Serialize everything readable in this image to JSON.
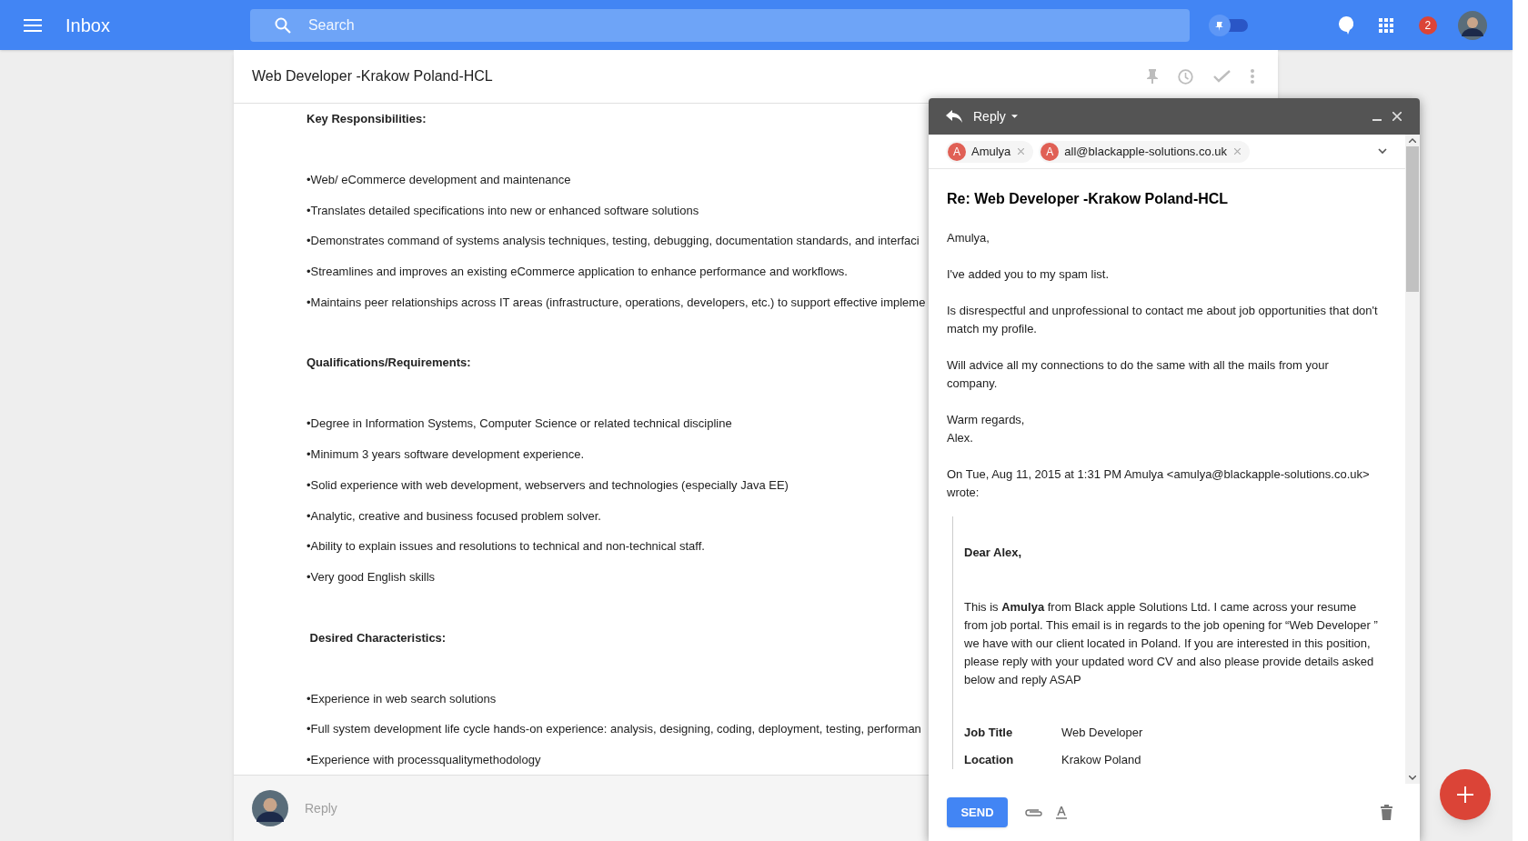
{
  "app_bar": {
    "title": "Inbox",
    "search": {
      "placeholder": "Search"
    },
    "notification_count": "2"
  },
  "thread": {
    "subject": "Web Developer -Krakow Poland-HCL",
    "body": [
      {
        "kind": "heading",
        "text": "Key Responsibilities:"
      },
      {
        "kind": "bullet",
        "text": "•Web/ eCommerce development and maintenance"
      },
      {
        "kind": "bullet",
        "text": "•Translates detailed specifications into new or enhanced software solutions"
      },
      {
        "kind": "bullet",
        "text": "•Demonstrates command of systems analysis techniques, testing, debugging, documentation standards, and interfaci"
      },
      {
        "kind": "bullet",
        "text": "•Streamlines and improves an existing eCommerce application to enhance performance and workflows."
      },
      {
        "kind": "bullet",
        "text": "•Maintains peer relationships across IT areas (infrastructure, operations, developers, etc.) to support effective impleme"
      },
      {
        "kind": "heading",
        "text": "Qualifications/Requirements:"
      },
      {
        "kind": "bullet",
        "text": "•Degree in Information Systems, Computer Science or related technical discipline"
      },
      {
        "kind": "bullet",
        "text": "•Minimum 3 years software development experience."
      },
      {
        "kind": "bullet",
        "text": "•Solid experience with web development, webservers and technologies (especially Java EE)"
      },
      {
        "kind": "bullet",
        "text": "•Analytic, creative and business focused problem solver."
      },
      {
        "kind": "bullet",
        "text": "•Ability to explain issues and resolutions to technical and non-technical staff."
      },
      {
        "kind": "bullet",
        "text": "•Very good English skills"
      },
      {
        "kind": "heading",
        "text": " Desired Characteristics:"
      },
      {
        "kind": "bullet",
        "text": "•Experience in web search solutions"
      },
      {
        "kind": "bullet",
        "text": "•Full system development life cycle hands-on experience: analysis, designing, coding, deployment, testing, performan"
      },
      {
        "kind": "bullet",
        "text": "•Experience with processqualitymethodology"
      }
    ],
    "reply": {
      "placeholder": "Reply"
    }
  },
  "compose": {
    "mode": "Reply",
    "recipients": [
      {
        "initial": "A",
        "label": "Amulya"
      },
      {
        "initial": "A",
        "label": "all@blackapple-solutions.co.uk"
      }
    ],
    "subject": "Re: Web Developer -Krakow Poland-HCL",
    "paragraphs": [
      "Amulya,",
      "I've added you to my spam list.",
      "Is disrespectful and unprofessional to contact me about job opportunities that don't match my profile.",
      "Will advice all my connections to do the same with all the mails from your company.",
      "Warm regards,\nAlex.",
      "On Tue, Aug 11, 2015 at 1:31 PM Amulya <amulya@blackapple-solutions.co.uk> wrote:"
    ],
    "quoted": {
      "greeting": "Dear Alex,",
      "paragraph": "This is **Amulya** from Black apple Solutions Ltd. I came across your resume from job portal. This email is in regards to the job opening for “Web Developer ” we have with our client located in Poland. If you are interested in this position, please reply with your updated word CV and also please provide details asked below and reply ASAP",
      "fields": [
        {
          "label": "Job Title",
          "value": "Web Developer"
        },
        {
          "label": "Location",
          "value": "Krakow Poland"
        }
      ]
    },
    "send_label": "SEND"
  }
}
